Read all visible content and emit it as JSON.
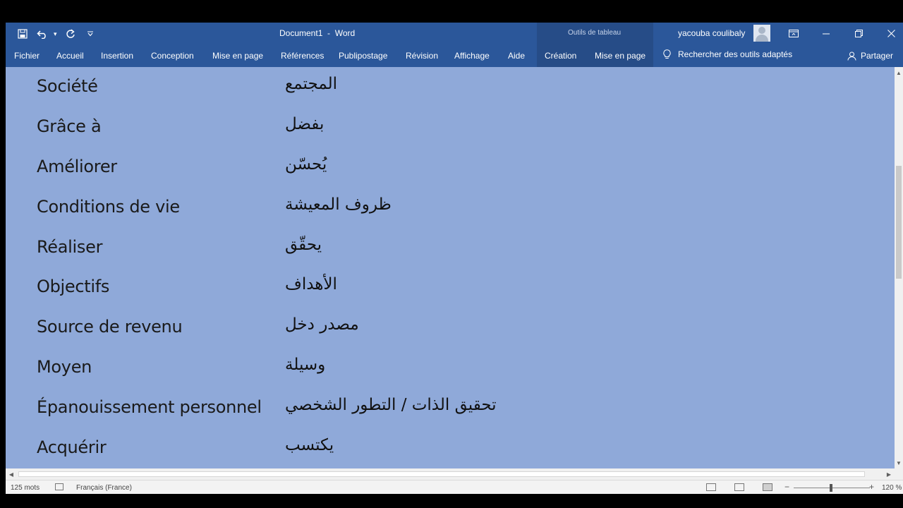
{
  "app": {
    "document_name": "Document1",
    "title_separator": "-",
    "app_name": "Word",
    "context_tab_group": "Outils de tableau",
    "user_name": "yacouba coulibaly"
  },
  "quick_access": {
    "save_icon": "floppy-disk-icon",
    "undo_icon": "undo-icon",
    "redo_icon": "redo-icon",
    "customize_icon": "chevron-down-icon"
  },
  "window_controls": {
    "ribbon_display_icon": "ribbon-display-icon",
    "minimize_icon": "minimize-icon",
    "restore_icon": "restore-icon",
    "close_icon": "close-icon"
  },
  "ribbon": {
    "tabs": [
      "Fichier",
      "Accueil",
      "Insertion",
      "Conception",
      "Mise en page",
      "Références",
      "Publipostage",
      "Révision",
      "Affichage",
      "Aide",
      "Création",
      "Mise en page"
    ],
    "tell_me": "Rechercher des outils adaptés",
    "share": "Partager"
  },
  "document": {
    "rows": [
      {
        "fr": "Société",
        "ar": "المجتمع"
      },
      {
        "fr": "Grâce à",
        "ar": "بفضل"
      },
      {
        "fr": "Améliorer",
        "ar": "يُحسّن"
      },
      {
        "fr": "Conditions de vie",
        "ar": "ظروف المعيشة"
      },
      {
        "fr": "Réaliser",
        "ar": "يحقّق"
      },
      {
        "fr": "Objectifs",
        "ar": "الأهداف"
      },
      {
        "fr": "Source de revenu",
        "ar": "مصدر دخل"
      },
      {
        "fr": "Moyen",
        "ar": "وسيلة"
      },
      {
        "fr": "Épanouissement personnel",
        "ar": "تحقيق الذات / التطور الشخصي"
      },
      {
        "fr": "Acquérir",
        "ar": "يكتسب"
      }
    ]
  },
  "status_bar": {
    "word_count": "125 mots",
    "language": "Français (France)",
    "zoom": "120 %"
  },
  "colors": {
    "ribbon": "#2b579a",
    "selection": "#8fa9d9",
    "context_tab": "#264c87"
  }
}
